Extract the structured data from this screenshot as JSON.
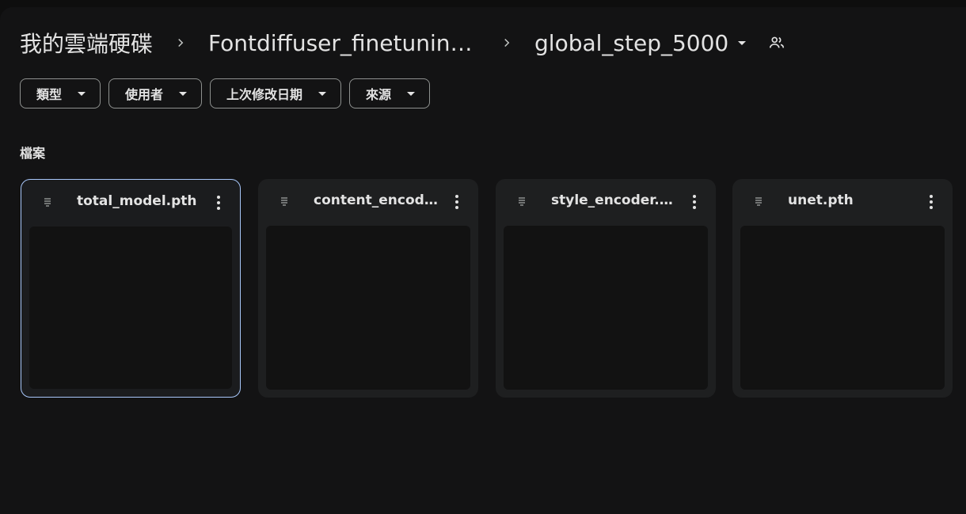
{
  "breadcrumb": {
    "root": "我的雲端硬碟",
    "parent": "Fontdiffuser_finetuning...",
    "current": "global_step_5000"
  },
  "filters": [
    {
      "label": "類型"
    },
    {
      "label": "使用者"
    },
    {
      "label": "上次修改日期"
    },
    {
      "label": "來源"
    }
  ],
  "section_title": "檔案",
  "files": [
    {
      "name": "total_model.pth",
      "selected": true
    },
    {
      "name": "content_encode...",
      "selected": false
    },
    {
      "name": "style_encoder.pth",
      "selected": false
    },
    {
      "name": "unet.pth",
      "selected": false
    }
  ],
  "colors": {
    "background": "#131314",
    "card": "#1e1f20",
    "selected_border": "#a8c7fa",
    "text": "#e3e3e3"
  }
}
